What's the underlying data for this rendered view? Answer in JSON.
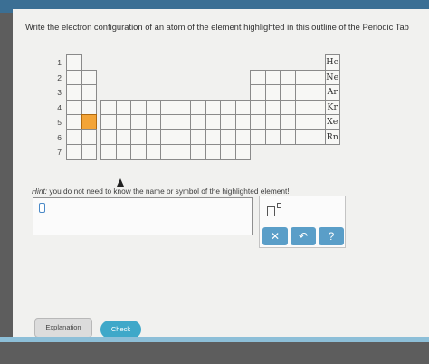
{
  "question": "Write the electron configuration of an atom of the element highlighted in this outline of the Periodic Tab",
  "periods": [
    "1",
    "2",
    "3",
    "4",
    "5",
    "6",
    "7"
  ],
  "noble_gases": [
    "He",
    "Ne",
    "Ar",
    "Kr",
    "Xe",
    "Rn"
  ],
  "hint": {
    "lead": "Hint:",
    "text": " you do not need to know the name or symbol of the highlighted element!"
  },
  "toolbar": {
    "superscript_icon": "superscript-icon",
    "clear_label": "✕",
    "undo_label": "↶",
    "help_label": "?"
  },
  "buttons": {
    "explanation": "Explanation",
    "check": "Check"
  },
  "colors": {
    "highlight": "#f3a437",
    "accent": "#5a9ec8",
    "check": "#3fa8c9"
  }
}
